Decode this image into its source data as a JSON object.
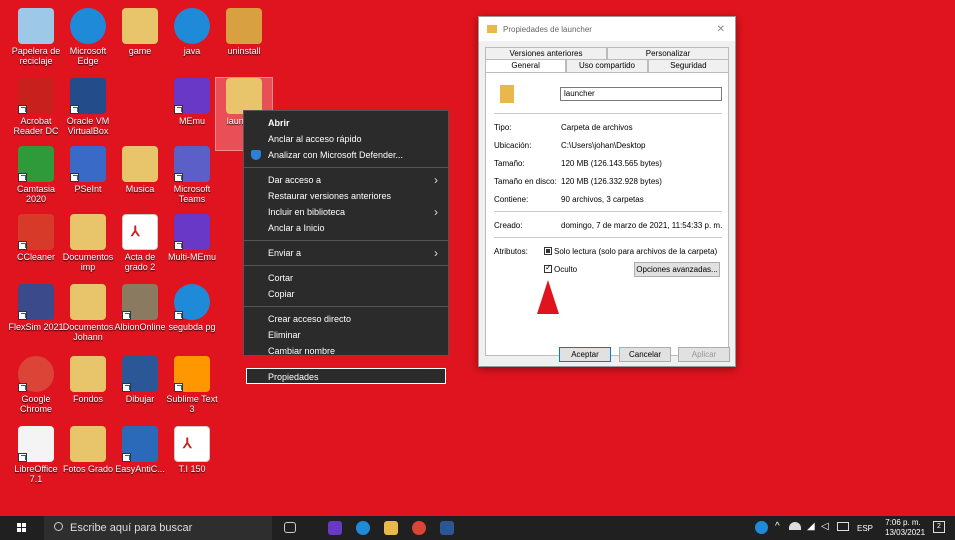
{
  "desktop": {
    "icons": [
      {
        "label": "Papelera de reciclaje",
        "icon": "recycle-bin-icon"
      },
      {
        "label": "Microsoft Edge",
        "icon": "edge-icon"
      },
      {
        "label": "game",
        "icon": "folder-icon"
      },
      {
        "label": "java",
        "icon": "edge-icon"
      },
      {
        "label": "uninstall",
        "icon": "installer-icon"
      },
      {
        "label": "Acrobat Reader DC",
        "icon": "acrobat-icon"
      },
      {
        "label": "Oracle VM VirtualBox",
        "icon": "virtualbox-icon"
      },
      {
        "label": "MEmu",
        "icon": "memu-icon"
      },
      {
        "label": "launcher",
        "icon": "folder-icon"
      },
      {
        "label": "Camtasia 2020",
        "icon": "camtasia-icon"
      },
      {
        "label": "PSeInt",
        "icon": "pseint-icon"
      },
      {
        "label": "Musica",
        "icon": "music-folder-icon"
      },
      {
        "label": "Microsoft Teams",
        "icon": "teams-icon"
      },
      {
        "label": "CCleaner",
        "icon": "ccleaner-icon"
      },
      {
        "label": "Documentos imp",
        "icon": "folder-icon"
      },
      {
        "label": "Acta de grado 2",
        "icon": "pdf-icon"
      },
      {
        "label": "Multi-MEmu",
        "icon": "memu-icon"
      },
      {
        "label": "FlexSim 2021",
        "icon": "flexsim-icon"
      },
      {
        "label": "Documentos Johann",
        "icon": "folder-icon"
      },
      {
        "label": "AlbionOnline",
        "icon": "albion-icon"
      },
      {
        "label": "segubda pg",
        "icon": "edge-icon"
      },
      {
        "label": "Google Chrome",
        "icon": "chrome-icon"
      },
      {
        "label": "Fondos",
        "icon": "folder-icon"
      },
      {
        "label": "Dibujar",
        "icon": "word-icon"
      },
      {
        "label": "Sublime Text 3",
        "icon": "sublime-icon"
      },
      {
        "label": "LibreOffice 7.1",
        "icon": "libreoffice-icon"
      },
      {
        "label": "Fotos Grado",
        "icon": "folder-icon"
      },
      {
        "label": "EasyAntiC...",
        "icon": "easyanticheat-icon"
      },
      {
        "label": "T.I 150",
        "icon": "pdf-icon"
      }
    ]
  },
  "context_menu": {
    "items": [
      {
        "label": "Abrir",
        "bold": true
      },
      {
        "label": "Anclar al acceso rápido"
      },
      {
        "label": "Analizar con Microsoft Defender..."
      },
      {
        "label": "Dar acceso a",
        "submenu": true
      },
      {
        "label": "Restaurar versiones anteriores"
      },
      {
        "label": "Incluir en biblioteca",
        "submenu": true
      },
      {
        "label": "Anclar a Inicio"
      },
      {
        "label": "Enviar a",
        "submenu": true
      },
      {
        "label": "Cortar"
      },
      {
        "label": "Copiar"
      },
      {
        "label": "Crear acceso directo"
      },
      {
        "label": "Eliminar"
      },
      {
        "label": "Cambiar nombre"
      },
      {
        "label": "Propiedades"
      }
    ]
  },
  "dialog": {
    "title": "Propiedades de launcher",
    "tabs_top": [
      "Versiones anteriores",
      "Personalizar"
    ],
    "tabs_bottom": [
      "General",
      "Uso compartido",
      "Seguridad"
    ],
    "name_value": "launcher",
    "props": {
      "tipo_k": "Tipo:",
      "tipo_v": "Carpeta de archivos",
      "ubic_k": "Ubicación:",
      "ubic_v": "C:\\Users\\johan\\Desktop",
      "tam_k": "Tamaño:",
      "tam_v": "120 MB (126.143.565 bytes)",
      "tamd_k": "Tamaño en disco:",
      "tamd_v": "120 MB (126.332.928 bytes)",
      "cont_k": "Contiene:",
      "cont_v": "90 archivos, 3 carpetas",
      "creado_k": "Creado:",
      "creado_v": "domingo, 7 de marzo de 2021, 11:54:33 p. m.",
      "atrib_k": "Atributos:",
      "readonly": "Solo lectura (solo para archivos de la carpeta)",
      "hidden": "Oculto",
      "advanced": "Opciones avanzadas..."
    },
    "buttons": {
      "ok": "Aceptar",
      "cancel": "Cancelar",
      "apply": "Aplicar"
    }
  },
  "taskbar": {
    "search_placeholder": "Escribe aquí para buscar",
    "lang": "ESP",
    "time": "7:06 p. m.",
    "date": "13/03/2021",
    "notif_count": "2"
  },
  "colors": {
    "desktop_bg": "#e0141e",
    "taskbar": "#202020",
    "menu_bg": "#2b2b2b"
  }
}
